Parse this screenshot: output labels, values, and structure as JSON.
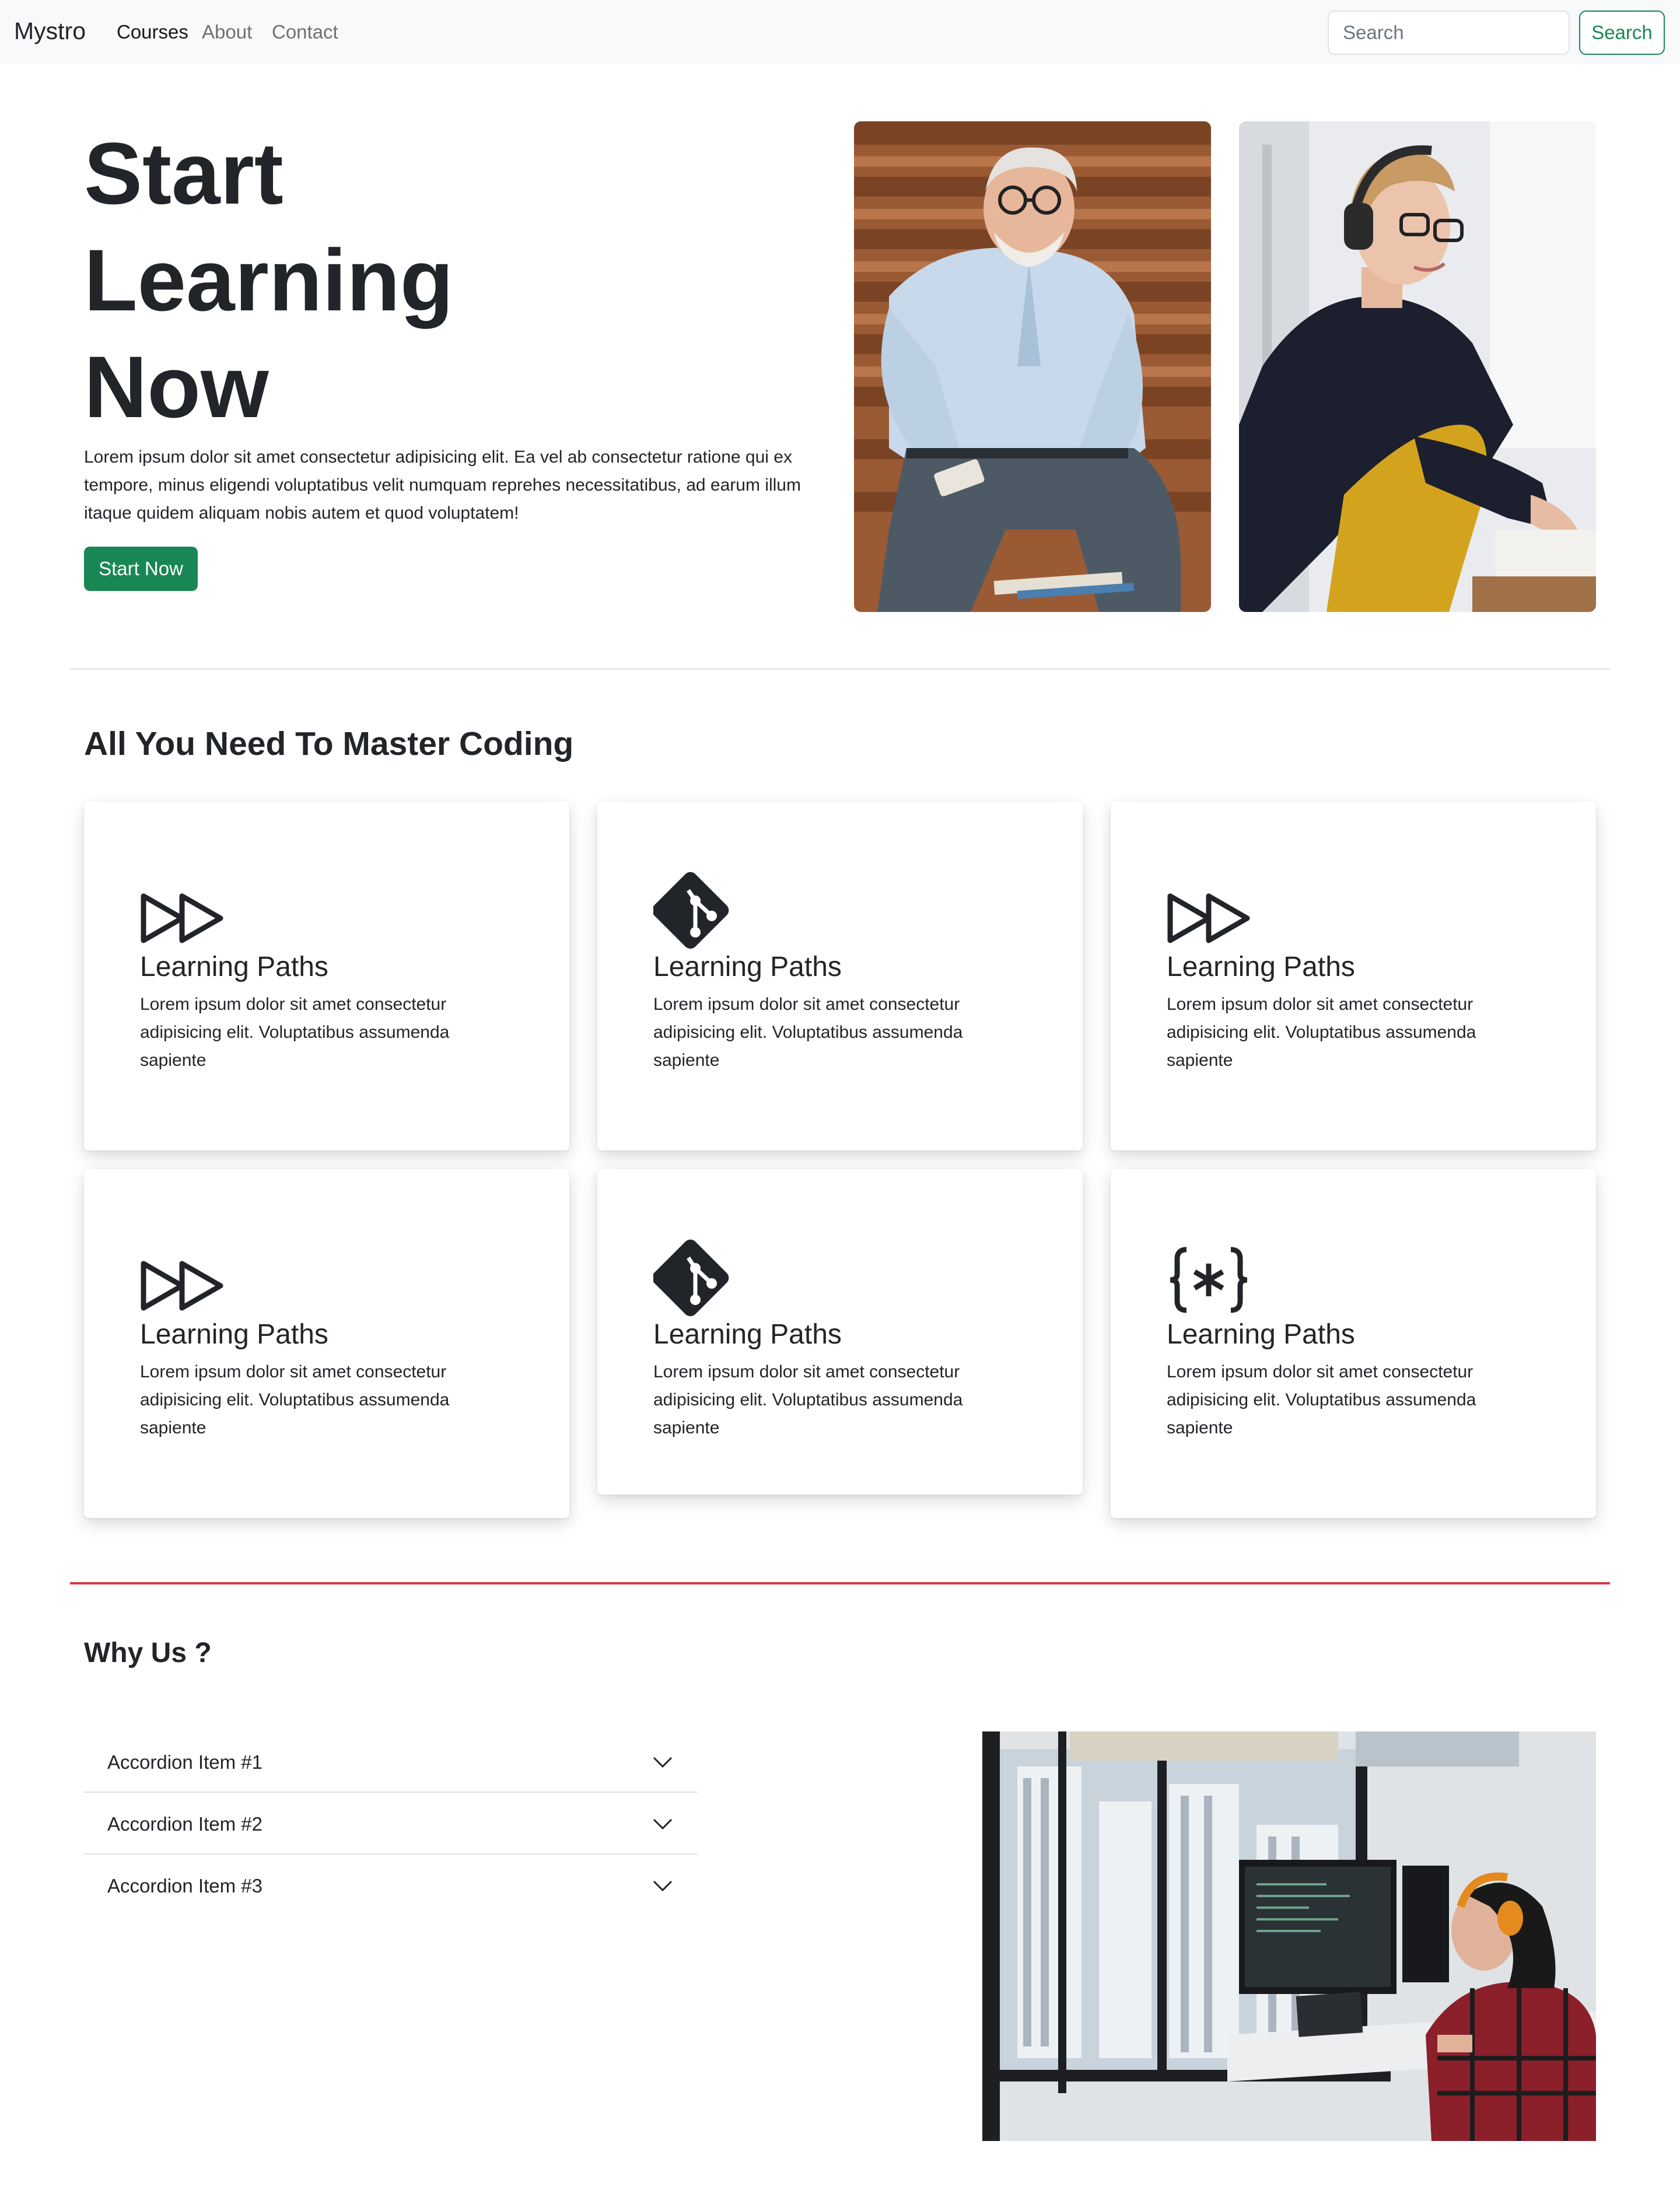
{
  "navbar": {
    "brand": "Mystro",
    "links": [
      {
        "label": "Courses",
        "active": true
      },
      {
        "label": "About",
        "active": false
      },
      {
        "label": "Contact",
        "active": false
      }
    ],
    "search_placeholder": "Search",
    "search_button": "Search"
  },
  "hero": {
    "title_lines": [
      "Start",
      "Learning",
      "Now"
    ],
    "text": "Lorem ipsum dolor sit amet consectetur adipisicing elit. Ea vel ab consectetur ratione qui ex tempore, minus eligendi voluptatibus velit numquam reprehes necessitatibus, ad earum illum itaque quidem aliquam nobis autem et quod voluptatem!",
    "button": "Start Now",
    "images": [
      "photo-older-man-with-phone",
      "photo-woman-with-headphones-writing"
    ]
  },
  "features": {
    "title": "All You Need To Master Coding",
    "cards": [
      {
        "icon": "fast-forward-icon",
        "title": "Learning Paths",
        "text": "Lorem ipsum dolor sit amet consectetur adipisicing elit. Voluptatibus assumenda sapiente"
      },
      {
        "icon": "git-icon",
        "title": "Learning Paths",
        "text": "Lorem ipsum dolor sit amet consectetur adipisicing elit. Voluptatibus assumenda sapiente"
      },
      {
        "icon": "fast-forward-icon",
        "title": "Learning Paths",
        "text": "Lorem ipsum dolor sit amet consectetur adipisicing elit. Voluptatibus assumenda sapiente"
      },
      {
        "icon": "fast-forward-icon",
        "title": "Learning Paths",
        "text": "Lorem ipsum dolor sit amet consectetur adipisicing elit. Voluptatibus assumenda sapiente"
      },
      {
        "icon": "git-icon",
        "title": "Learning Paths",
        "text": "Lorem ipsum dolor sit amet consectetur adipisicing elit. Voluptatibus assumenda sapiente"
      },
      {
        "icon": "braces-asterisk-icon",
        "title": "Learning Paths",
        "text": "Lorem ipsum dolor sit amet consectetur adipisicing elit. Voluptatibus assumenda sapiente"
      }
    ]
  },
  "why": {
    "title": "Why Us ?",
    "accordion": [
      {
        "label": "Accordion Item #1"
      },
      {
        "label": "Accordion Item #2"
      },
      {
        "label": "Accordion Item #3"
      }
    ],
    "image": "photo-woman-coding-at-window-desk"
  },
  "colors": {
    "primary_green": "#198754",
    "divider_red": "#dc3545",
    "navbar_bg": "#f8f9fa"
  }
}
